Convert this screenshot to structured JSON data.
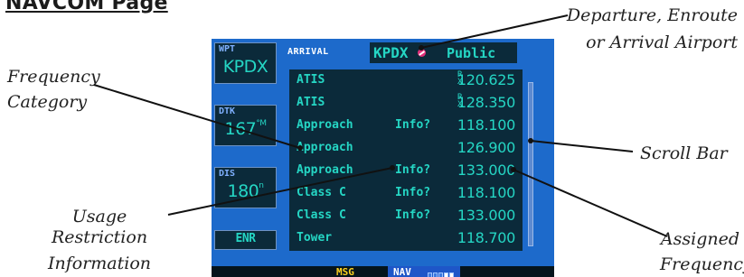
{
  "heading": "NAVCOM Page",
  "callouts": {
    "departure": [
      "Departure, Enroute",
      "or Arrival Airport"
    ],
    "frequency_category": [
      "Frequency",
      "Category"
    ],
    "scroll_bar": "Scroll Bar",
    "usage_restriction": [
      "Usage Restriction",
      "Information"
    ],
    "assigned_frequency": [
      "Assigned",
      "Frequency"
    ]
  },
  "screen": {
    "left_panel": {
      "wpt": {
        "label": "WPT",
        "value": "KPDX"
      },
      "dtk": {
        "label": "DTK",
        "value": "167",
        "unit": "°M"
      },
      "dis": {
        "label": "DIS",
        "value": "180",
        "unit": "n"
      },
      "mode": "ENR"
    },
    "header": {
      "page": "ARRIVAL",
      "airport": "KPDX",
      "airport_type": "Public"
    },
    "rows": [
      {
        "category": "ATIS",
        "info": "",
        "rx": "R\nX",
        "freq": "120.625"
      },
      {
        "category": "ATIS",
        "info": "",
        "rx": "R\nX",
        "freq": "128.350"
      },
      {
        "category": "Approach",
        "info": "Info?",
        "rx": "",
        "freq": "118.100"
      },
      {
        "category": "Approach",
        "info": "",
        "rx": "",
        "freq": "126.900"
      },
      {
        "category": "Approach",
        "info": "Info?",
        "rx": "",
        "freq": "133.000"
      },
      {
        "category": "Class C",
        "info": "Info?",
        "rx": "",
        "freq": "118.100"
      },
      {
        "category": "Class C",
        "info": "Info?",
        "rx": "",
        "freq": "133.000"
      },
      {
        "category": "Tower",
        "info": "",
        "rx": "",
        "freq": "118.700"
      }
    ],
    "status": {
      "msg": "MSG",
      "nav": "NAV"
    }
  },
  "colors": {
    "screen_bg": "#1d6acb",
    "panel_bg": "#0b2a3a",
    "cyan_text": "#25d6c4",
    "msg_yellow": "#ffd21f"
  }
}
